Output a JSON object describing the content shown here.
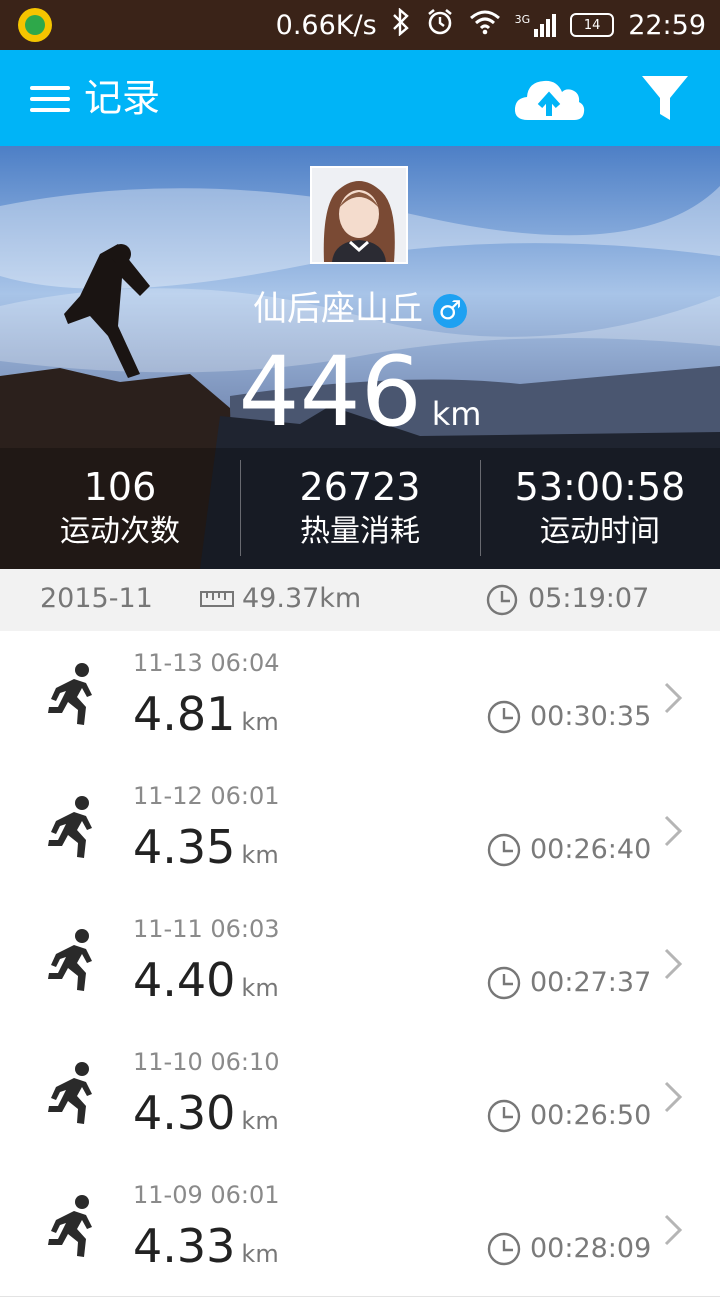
{
  "status_bar": {
    "net_speed": "0.66K/s",
    "battery": "14",
    "time": "22:59",
    "network": "3G"
  },
  "app_bar": {
    "title": "记录",
    "icons": [
      "menu-icon",
      "cloud-upload-icon",
      "filter-icon"
    ]
  },
  "profile": {
    "name": "仙后座山丘",
    "gender_symbol": "♂",
    "total_distance": "446",
    "total_unit": "km",
    "stats": [
      {
        "value": "106",
        "label": "运动次数"
      },
      {
        "value": "26723",
        "label": "热量消耗"
      },
      {
        "value": "53:00:58",
        "label": "运动时间"
      }
    ]
  },
  "month_summary": {
    "month": "2015-11",
    "distance": "49.37km",
    "duration": "05:19:07"
  },
  "records": [
    {
      "datetime": "11-13 06:04",
      "distance": "4.81",
      "unit": "km",
      "duration": "00:30:35"
    },
    {
      "datetime": "11-12 06:01",
      "distance": "4.35",
      "unit": "km",
      "duration": "00:26:40"
    },
    {
      "datetime": "11-11 06:03",
      "distance": "4.40",
      "unit": "km",
      "duration": "00:27:37"
    },
    {
      "datetime": "11-10 06:10",
      "distance": "4.30",
      "unit": "km",
      "duration": "00:26:50"
    },
    {
      "datetime": "11-09 06:01",
      "distance": "4.33",
      "unit": "km",
      "duration": "00:28:09"
    }
  ],
  "colors": {
    "app_bar": "#00b4f7",
    "status_bar": "#3a2318",
    "gender_badge": "#1ea1f2"
  }
}
